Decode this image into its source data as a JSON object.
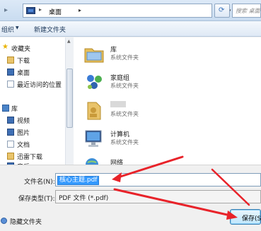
{
  "address_bar": {
    "location": "桌面",
    "separator": "▸",
    "search_placeholder": "搜索 桌面"
  },
  "toolbar": {
    "organize_label": "组织",
    "new_folder_label": "新建文件夹"
  },
  "nav": {
    "items": [
      {
        "label": "收藏夹",
        "icon": "star-icon"
      },
      {
        "label": "下载",
        "icon": "download-folder-icon"
      },
      {
        "label": "桌面",
        "icon": "desktop-icon"
      },
      {
        "label": "最近访问的位置",
        "icon": "recent-places-icon"
      },
      {
        "label": "库",
        "icon": "library-icon"
      },
      {
        "label": "视频",
        "icon": "video-library-icon"
      },
      {
        "label": "图片",
        "icon": "picture-library-icon"
      },
      {
        "label": "文档",
        "icon": "document-library-icon"
      },
      {
        "label": "迅雷下载",
        "icon": "thunder-download-icon"
      },
      {
        "label": "音乐",
        "icon": "music-library-icon"
      }
    ]
  },
  "files": [
    {
      "name": "库",
      "type": "系统文件夹",
      "icon": "library-folder-icon"
    },
    {
      "name": "家庭组",
      "type": "系统文件夹",
      "icon": "homegroup-icon"
    },
    {
      "name": "",
      "type": "系统文件夹",
      "icon": "user-folder-icon"
    },
    {
      "name": "计算机",
      "type": "系统文件夹",
      "icon": "computer-icon"
    },
    {
      "name": "网络",
      "type": "",
      "icon": "network-icon"
    }
  ],
  "form": {
    "filename_label": "文件名(N):",
    "filename_value": "核心主题.pdf",
    "type_label": "保存类型(T):",
    "type_value": "PDF 文件 (*.pdf)",
    "hide_folders_label": "隐藏文件夹",
    "save_label": "保存(S)"
  },
  "colors": {
    "selection": "#3399ff",
    "annotation": "#e8232a"
  }
}
